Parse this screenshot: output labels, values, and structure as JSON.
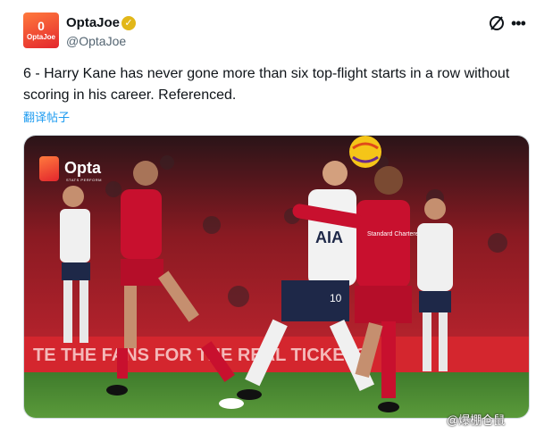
{
  "author": {
    "avatar_glyph": "0",
    "avatar_brand": "OptaJoe",
    "display_name": "OptaJoe",
    "handle": "@OptaJoe",
    "verified": "✓",
    "more": "•••"
  },
  "tweet": {
    "text": "6 - Harry Kane has never gone more than six top-flight starts in a row without scoring in his career. Referenced.",
    "translate_label": "翻译帖子"
  },
  "media": {
    "logo_word": "Opta",
    "logo_sub": "STATS PERFORM",
    "shirt_sponsor_spurs": "AIA",
    "shirt_sponsor_lfc": "Standard Chartered",
    "shirt_number_kane": "10",
    "board_text": "TE THE FANS FOR THE REAL TICKETS"
  },
  "watermark": "@爆棚仓鼠",
  "colors": {
    "accent_link": "#1d9bf0",
    "handle_gray": "#536471",
    "verified_gold": "#e2b719",
    "opta_orange": "#ff6b35",
    "liverpool_red": "#c8102e"
  }
}
